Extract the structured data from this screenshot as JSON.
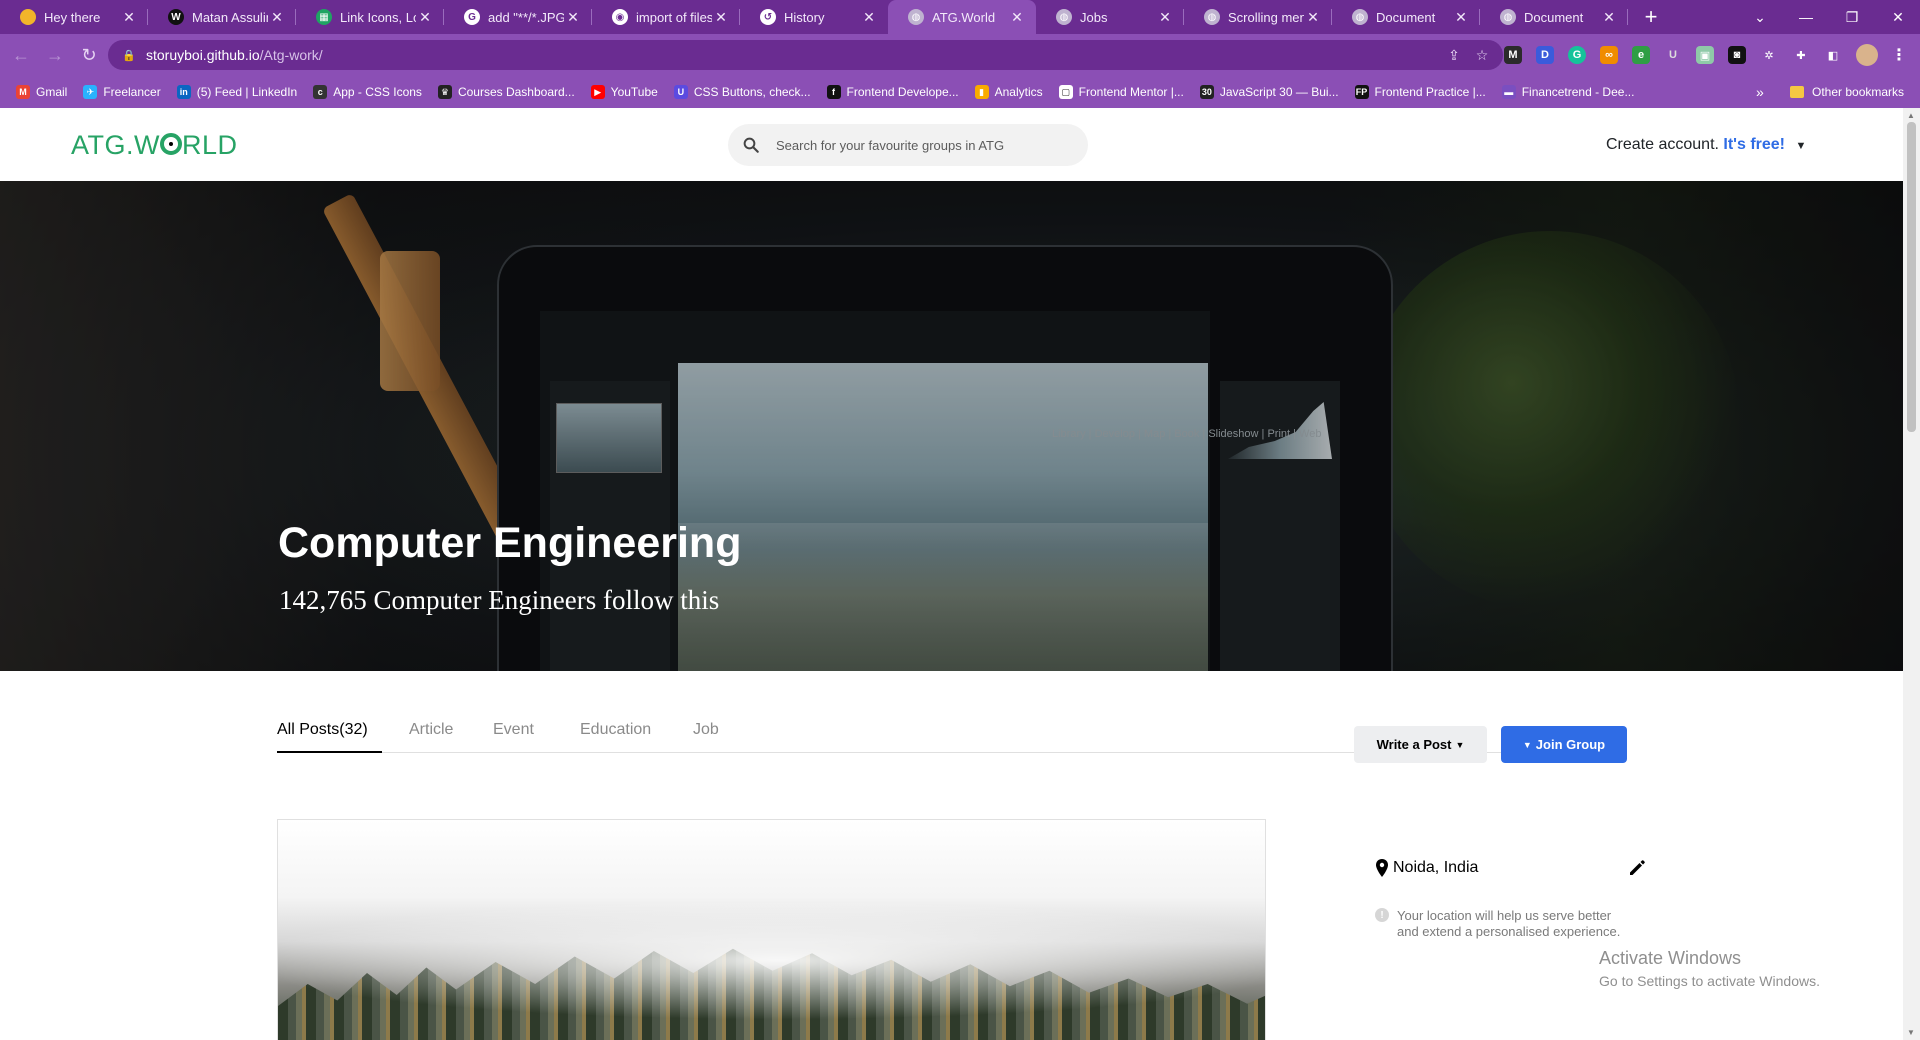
{
  "browser": {
    "tabs": [
      {
        "title": "Hey there",
        "favicon": "yellow-dot-icon",
        "color": "#f2b52a",
        "glyph": ""
      },
      {
        "title": "Matan Assulin |",
        "favicon": "framer-icon",
        "color": "#111111",
        "glyph": "W"
      },
      {
        "title": "Link Icons, Logo",
        "favicon": "sheet-icon",
        "color": "#1fa463",
        "glyph": "▦"
      },
      {
        "title": "add \"**/*.JPG\" t",
        "favicon": "google-icon",
        "color": "#ffffff",
        "glyph": "G"
      },
      {
        "title": "import of files w",
        "favicon": "github-icon",
        "color": "#ffffff",
        "glyph": "◉"
      },
      {
        "title": "History",
        "favicon": "history-icon",
        "color": "#ffffff",
        "glyph": "↺"
      },
      {
        "title": "ATG.World",
        "favicon": "globe-icon",
        "color": "#bfb3d0",
        "glyph": "◍"
      },
      {
        "title": "Jobs",
        "favicon": "globe-icon",
        "color": "#bfb3d0",
        "glyph": "◍"
      },
      {
        "title": "Scrolling menu",
        "favicon": "globe-icon",
        "color": "#bfb3d0",
        "glyph": "◍"
      },
      {
        "title": "Document",
        "favicon": "globe-icon",
        "color": "#bfb3d0",
        "glyph": "◍"
      },
      {
        "title": "Document",
        "favicon": "globe-icon",
        "color": "#bfb3d0",
        "glyph": "◍"
      }
    ],
    "active_tab_index": 6,
    "url_host": "storuyboi.github.io",
    "url_path": "/Atg-work/",
    "bookmarks": [
      {
        "label": "Gmail",
        "icon": "gmail-icon",
        "color": "#ea4335",
        "glyph": "M"
      },
      {
        "label": "Freelancer",
        "icon": "freelancer-icon",
        "color": "#29b2fe",
        "glyph": "✈"
      },
      {
        "label": "(5) Feed | LinkedIn",
        "icon": "linkedin-icon",
        "color": "#0a66c2",
        "glyph": "in"
      },
      {
        "label": "App - CSS Icons",
        "icon": "css-icons-icon",
        "color": "#333333",
        "glyph": "c"
      },
      {
        "label": "Courses Dashboard...",
        "icon": "crown-icon",
        "color": "#222222",
        "glyph": "♛"
      },
      {
        "label": "YouTube",
        "icon": "youtube-icon",
        "color": "#ff0000",
        "glyph": "▶"
      },
      {
        "label": "CSS Buttons, check...",
        "icon": "uiverse-icon",
        "color": "#5b4be0",
        "glyph": "U"
      },
      {
        "label": "Frontend Develope...",
        "icon": "frontend-icon",
        "color": "#111111",
        "glyph": "f"
      },
      {
        "label": "Analytics",
        "icon": "analytics-icon",
        "color": "#f9ab00",
        "glyph": "▮"
      },
      {
        "label": "Frontend Mentor |...",
        "icon": "fm-icon",
        "color": "#ffffff",
        "glyph": "▢"
      },
      {
        "label": "JavaScript 30 — Bui...",
        "icon": "js30-icon",
        "color": "#222222",
        "glyph": "30"
      },
      {
        "label": "Frontend Practice |...",
        "icon": "fp-icon",
        "color": "#111111",
        "glyph": "FP"
      },
      {
        "label": "Financetrend - Dee...",
        "icon": "financetrend-icon",
        "color": "#7a4fc0",
        "glyph": "▬"
      }
    ],
    "other_bookmarks": "Other bookmarks"
  },
  "site": {
    "logo_left": "ATG.W",
    "logo_right": "RLD",
    "search_placeholder": "Search for your favourite groups in ATG",
    "create_prefix": "Create account.",
    "create_free": "It's free!"
  },
  "hero": {
    "title": "Computer Engineering",
    "followers": "142,765 Computer Engineers follow this",
    "screen_menu": "Library | Develop | Map | Book | Slideshow | Print | Web"
  },
  "post_tabs": [
    {
      "label": "All Posts(32)",
      "active": true
    },
    {
      "label": "Article",
      "active": false
    },
    {
      "label": "Event",
      "active": false
    },
    {
      "label": "Education",
      "active": false
    },
    {
      "label": "Job",
      "active": false
    }
  ],
  "actions": {
    "write_post": "Write a Post",
    "join_group": "Join Group"
  },
  "sidebar": {
    "location": "Noida, India",
    "info_line1": "Your location will help us serve better",
    "info_line2": "and extend a personalised experience."
  },
  "watermark": {
    "line1": "Activate Windows",
    "line2": "Go to Settings to activate Windows."
  },
  "colors": {
    "browser_frame": "#6a2c91",
    "browser_toolbar": "#8b4fb5",
    "brand_green": "#27a365",
    "accent_blue": "#2f6ce5"
  }
}
